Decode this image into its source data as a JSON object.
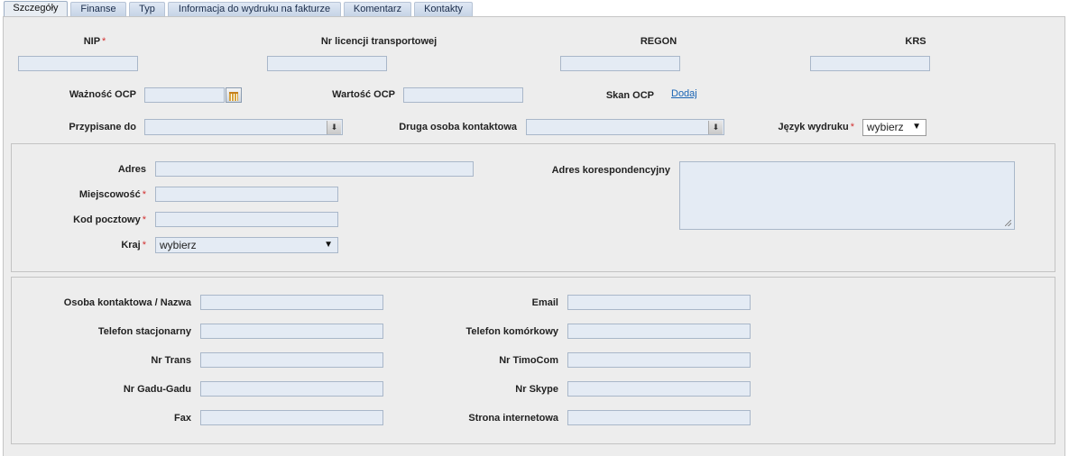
{
  "tabs": [
    "Szczegóły",
    "Finanse",
    "Typ",
    "Informacja do wydruku na fakturze",
    "Komentarz",
    "Kontakty"
  ],
  "required_marker": "*",
  "top": {
    "nip_label": "NIP",
    "licencja_label": "Nr licencji transportowej",
    "regon_label": "REGON",
    "krs_label": "KRS",
    "waznosc_label": "Ważność OCP",
    "wartosc_label": "Wartość OCP",
    "skan_label": "Skan OCP",
    "skan_link": "Dodaj",
    "przypisane_label": "Przypisane do",
    "druga_label": "Druga osoba kontaktowa",
    "jezyk_label": "Język wydruku",
    "jezyk_value": "wybierz"
  },
  "address": {
    "adres_label": "Adres",
    "miejscowosc_label": "Miejscowość",
    "kod_label": "Kod pocztowy",
    "kraj_label": "Kraj",
    "kraj_value": "wybierz",
    "korespondencyjny_label": "Adres korespondencyjny"
  },
  "contact": {
    "osoba_label": "Osoba kontaktowa / Nazwa",
    "tel_stac_label": "Telefon stacjonarny",
    "trans_label": "Nr Trans",
    "gadu_label": "Nr Gadu-Gadu",
    "fax_label": "Fax",
    "email_label": "Email",
    "tel_kom_label": "Telefon komórkowy",
    "timocom_label": "Nr TimoCom",
    "skype_label": "Nr Skype",
    "www_label": "Strona internetowa"
  },
  "colors": {
    "required": "#d23131",
    "link": "#1a64b4",
    "input_bg": "#e4ebf4"
  }
}
